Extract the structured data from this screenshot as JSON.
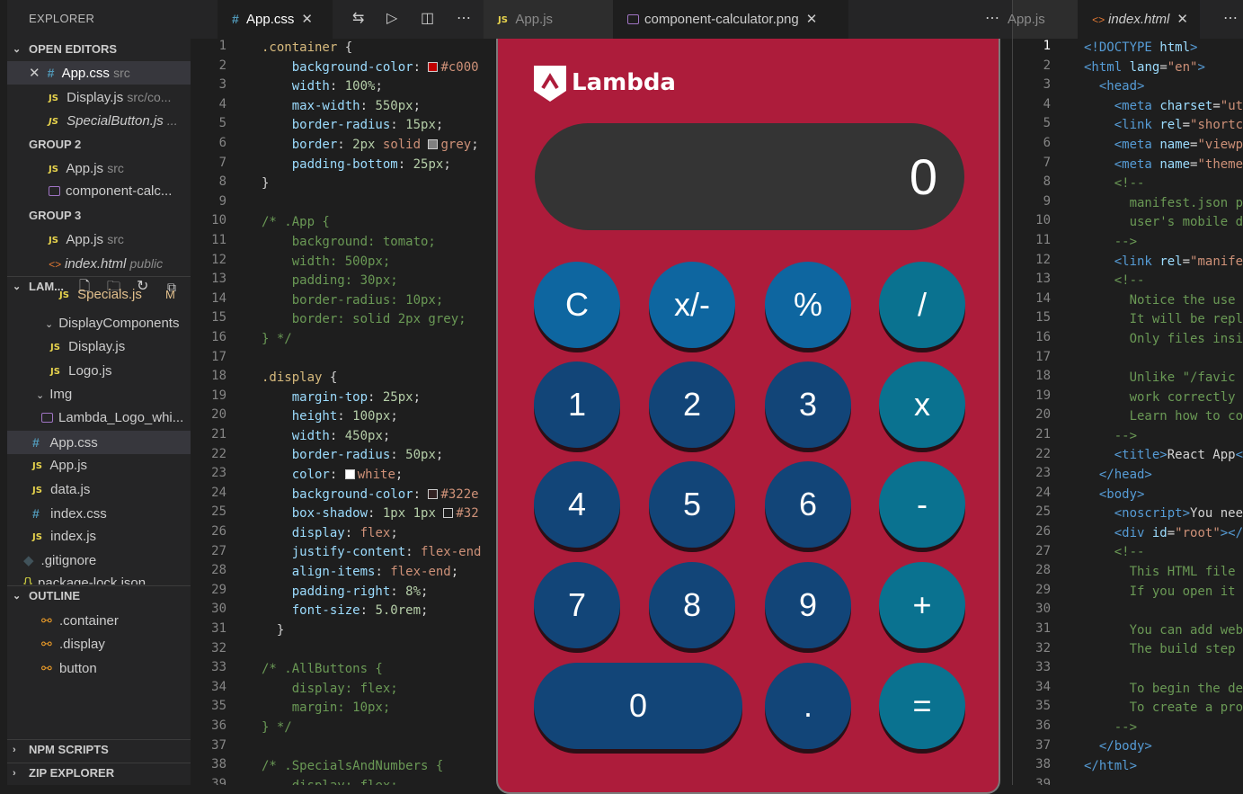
{
  "sidebar": {
    "title": "EXPLORER",
    "open_editors": {
      "header": "OPEN EDITORS",
      "items": [
        {
          "name": "App.css",
          "desc": "src"
        },
        {
          "name": "Display.js",
          "desc": "src/co..."
        },
        {
          "name": "SpecialButton.js",
          "desc": "..."
        }
      ]
    },
    "group2": {
      "header": "GROUP 2",
      "items": [
        {
          "name": "App.js",
          "desc": "src"
        },
        {
          "name": "component-calc..."
        }
      ]
    },
    "group3": {
      "header": "GROUP 3",
      "items": [
        {
          "name": "App.js",
          "desc": "src"
        },
        {
          "name": "index.html",
          "desc": "public"
        }
      ]
    },
    "project": {
      "header": "LAM...",
      "partial": "Specials.js",
      "partial_badge": "M",
      "items": [
        "DisplayComponents",
        "Display.js",
        "Logo.js",
        "Img",
        "Lambda_Logo_whi...",
        "App.css",
        "App.js",
        "data.js",
        "index.css",
        "index.js",
        ".gitignore",
        "package-lock.json"
      ]
    },
    "outline": {
      "header": "OUTLINE",
      "items": [
        ".container",
        ".display",
        "button"
      ]
    },
    "npm": "NPM SCRIPTS",
    "zip": "ZIP EXPLORER"
  },
  "editor1": {
    "tab": "App.css"
  },
  "editor2": {
    "tabs": [
      "App.js",
      "component-calculator.png"
    ]
  },
  "editor3": {
    "tabs": [
      "App.js",
      "index.html"
    ]
  },
  "calculator": {
    "brand": "Lambda",
    "display": "0",
    "rows": [
      [
        "C",
        "x/-",
        "%",
        "/"
      ],
      [
        "1",
        "2",
        "3",
        "x"
      ],
      [
        "4",
        "5",
        "6",
        "-"
      ],
      [
        "7",
        "8",
        "9",
        "+"
      ],
      [
        "0",
        ".",
        "="
      ]
    ]
  },
  "colors": {
    "calc_bg": "#ad1c3b",
    "num_btn": "#124578",
    "spec_btn": "#0e66a0",
    "op_btn": "#0a7290",
    "display_bg": "#343434"
  }
}
